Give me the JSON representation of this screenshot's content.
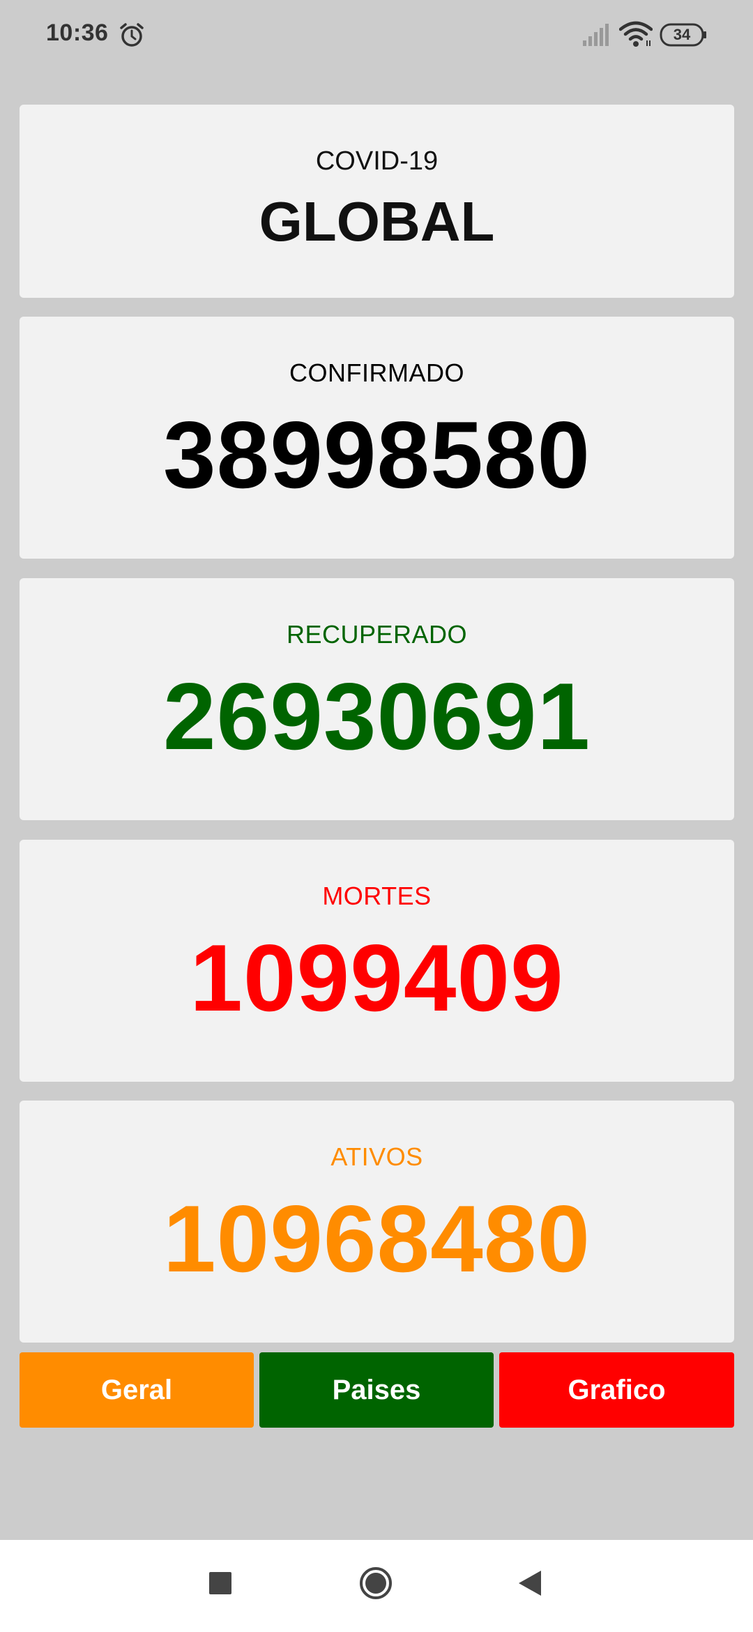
{
  "status_bar": {
    "time": "10:36",
    "battery": "34",
    "icons": [
      "alarm-icon",
      "signal-icon",
      "wifi-icon",
      "battery-icon"
    ]
  },
  "header": {
    "subtitle": "COVID-19",
    "title": "GLOBAL"
  },
  "stats": {
    "confirmed": {
      "label": "CONFIRMADO",
      "value": "38998580",
      "color": "#000000"
    },
    "recovered": {
      "label": "RECUPERADO",
      "value": "26930691",
      "color": "#006400"
    },
    "deaths": {
      "label": "MORTES",
      "value": "1099409",
      "color": "#ff0000"
    },
    "active": {
      "label": "ATIVOS",
      "value": "10968480",
      "color": "#ff8c00"
    }
  },
  "buttons": {
    "geral": {
      "label": "Geral",
      "color": "#ff8c00"
    },
    "paises": {
      "label": "Paises",
      "color": "#006400"
    },
    "grafico": {
      "label": "Grafico",
      "color": "#ff0000"
    }
  },
  "nav_bar": {
    "icons": [
      "recents-icon",
      "home-icon",
      "back-icon"
    ]
  }
}
